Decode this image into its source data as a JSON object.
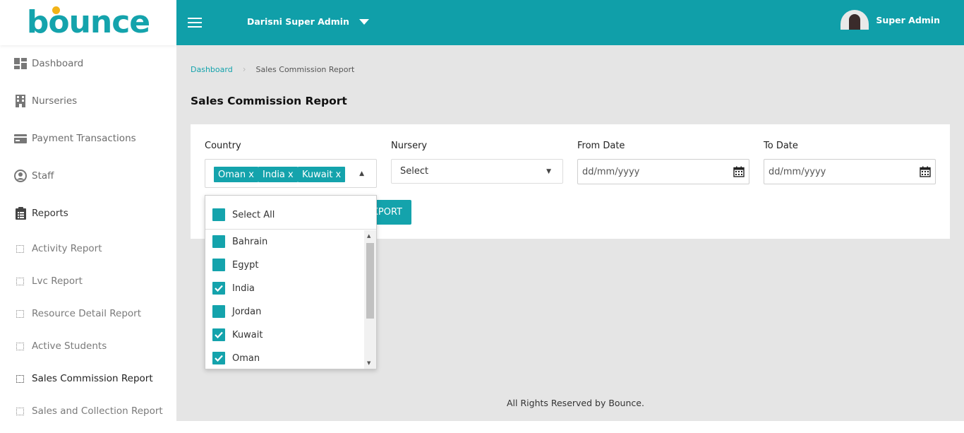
{
  "brand": {
    "name": "bounce",
    "colors": {
      "primary": "#109fa9",
      "accent": "#f2b317"
    }
  },
  "header": {
    "menu_icon": "hamburger-icon",
    "tenant_label": "Darisni Super Admin",
    "user_name": "Super Admin"
  },
  "sidebar": {
    "items": [
      {
        "label": "Dashboard",
        "icon": "dashboard-icon"
      },
      {
        "label": "Nurseries",
        "icon": "building-icon"
      },
      {
        "label": "Payment Transactions",
        "icon": "credit-card-icon"
      },
      {
        "label": "Staff",
        "icon": "user-circle-icon"
      },
      {
        "label": "Reports",
        "icon": "clipboard-list-icon"
      }
    ],
    "report_items": [
      {
        "label": "Activity Report"
      },
      {
        "label": "Lvc Report"
      },
      {
        "label": "Resource Detail Report"
      },
      {
        "label": "Active Students"
      },
      {
        "label": "Sales Commission Report",
        "active": true
      },
      {
        "label": "Sales and Collection Report"
      }
    ]
  },
  "breadcrumb": {
    "home": "Dashboard",
    "current": "Sales Commission Report"
  },
  "page": {
    "title": "Sales Commission Report"
  },
  "filters": {
    "country": {
      "label": "Country",
      "selected": [
        "Oman x",
        "India x",
        "Kuwait x"
      ]
    },
    "nursery": {
      "label": "Nursery",
      "value": "Select"
    },
    "from_date": {
      "label": "From Date",
      "placeholder": "dd/mm/yyyy"
    },
    "to_date": {
      "label": "To Date",
      "placeholder": "dd/mm/yyyy"
    },
    "export_label": "XPORT"
  },
  "country_dropdown": {
    "select_all": "Select All",
    "options": [
      {
        "label": "Bahrain",
        "checked": false
      },
      {
        "label": "Egypt",
        "checked": false
      },
      {
        "label": "India",
        "checked": true
      },
      {
        "label": "Jordan",
        "checked": false
      },
      {
        "label": "Kuwait",
        "checked": true
      },
      {
        "label": "Oman",
        "checked": true
      }
    ]
  },
  "footer": {
    "text": "All Rights Reserved by Bounce."
  }
}
